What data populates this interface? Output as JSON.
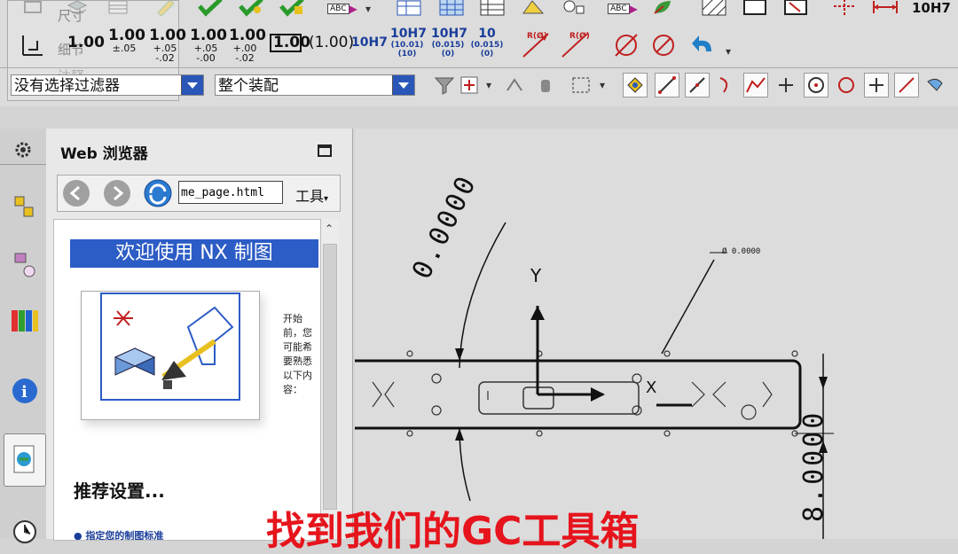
{
  "menu_ghost": {
    "dimension": "尺寸",
    "detail": "细节",
    "annotation": "注释"
  },
  "toolbar_row1": {
    "abc_label_1": "ABC",
    "abc_label_2": "ABC",
    "fit_label": "10H7"
  },
  "tolerance_buttons": [
    {
      "top": "1.00",
      "bottom": ""
    },
    {
      "top": "1.00",
      "bottom": "±.05"
    },
    {
      "top": "1.00",
      "bottom": "+.05 -.02"
    },
    {
      "top": "1.00",
      "bottom": "+.05 -.00"
    },
    {
      "top": "1.00",
      "bottom": "+.00 -.02"
    }
  ],
  "basic_dim": "1.00",
  "ref_dim": "(1.00)",
  "fit_buttons": [
    {
      "top": "10H7",
      "bottom": ""
    },
    {
      "top": "10H7",
      "bottom": "(10.01) (10)"
    },
    {
      "top": "10H7",
      "bottom": "(0.015) (0)"
    },
    {
      "top": "10",
      "bottom": "(0.015) (0)"
    }
  ],
  "radius_labels": [
    "R(Ø)",
    "R(Ø)"
  ],
  "filter": {
    "selection_filter": "没有选择过滤器",
    "scope": "整个装配"
  },
  "browser": {
    "title": "Web 浏览器",
    "address": "me_page.html",
    "tools_menu": "工具",
    "banner": "欢迎使用 NX 制图",
    "intro_text": [
      "开始",
      "前，您",
      "可能希",
      "要熟悉",
      "以下内",
      "容："
    ],
    "section_heading": "推荐设置...",
    "link_text": "指定您的制图标准"
  },
  "drawing": {
    "y_axis": "Y",
    "x_axis": "X",
    "dim_left": "0.0000",
    "dim_top_right": "Ø 0.0000",
    "dim_bottom_right": "8.0000"
  },
  "caption": "找到我们的GC工具箱",
  "colors": {
    "caption": "#e6141c",
    "banner": "#2c5cc5",
    "accent": "#1a3d9a"
  }
}
